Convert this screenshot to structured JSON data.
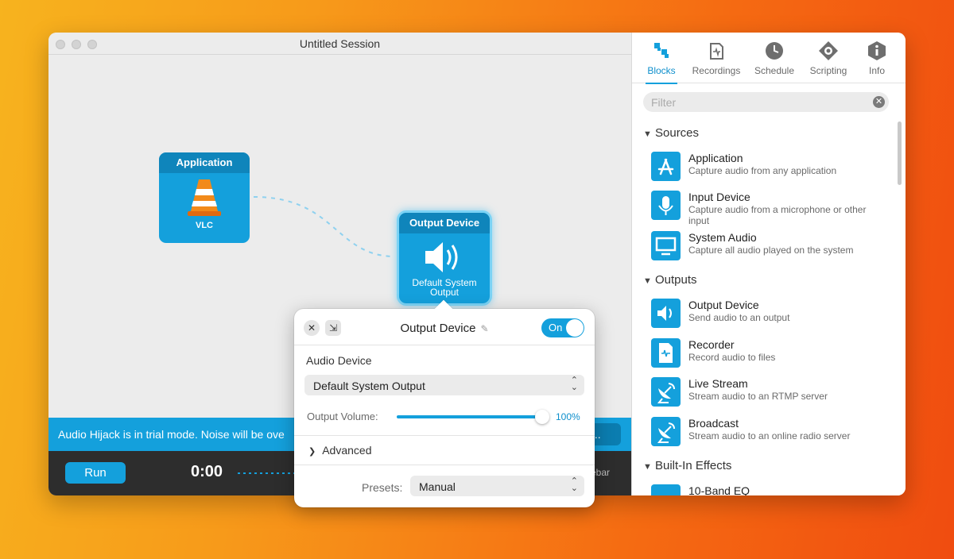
{
  "window": {
    "title": "Untitled Session"
  },
  "canvas": {
    "app_block": {
      "header": "Application",
      "label": "VLC"
    },
    "output_block": {
      "header": "Output Device",
      "label": "Default System Output"
    }
  },
  "trial": {
    "message": "Audio Hijack is in trial mode. Noise will be ove",
    "button_label": "s..."
  },
  "bottom": {
    "run_label": "Run",
    "timer": "0:00",
    "sidebar_label": "ebar"
  },
  "sidebar": {
    "tabs": [
      {
        "label": "Blocks",
        "icon": "blocks-icon",
        "active": true
      },
      {
        "label": "Recordings",
        "icon": "recordings-icon"
      },
      {
        "label": "Schedule",
        "icon": "clock-icon"
      },
      {
        "label": "Scripting",
        "icon": "scripting-icon"
      },
      {
        "label": "Info",
        "icon": "info-icon"
      }
    ],
    "filter_placeholder": "Filter",
    "sections": [
      {
        "title": "Sources",
        "items": [
          {
            "title": "Application",
            "desc": "Capture audio from any application",
            "icon": "app-store-icon"
          },
          {
            "title": "Input Device",
            "desc": "Capture audio from a microphone or other input",
            "icon": "microphone-icon"
          },
          {
            "title": "System Audio",
            "desc": "Capture all audio played on the system",
            "icon": "monitor-icon"
          }
        ]
      },
      {
        "title": "Outputs",
        "items": [
          {
            "title": "Output Device",
            "desc": "Send audio to an output",
            "icon": "speaker-icon"
          },
          {
            "title": "Recorder",
            "desc": "Record audio to files",
            "icon": "recorder-icon"
          },
          {
            "title": "Live Stream",
            "desc": "Stream audio to an RTMP server",
            "icon": "satellite-icon"
          },
          {
            "title": "Broadcast",
            "desc": "Stream audio to an online radio server",
            "icon": "broadcast-icon"
          }
        ]
      },
      {
        "title": "Built-In Effects",
        "items": [
          {
            "title": "10-Band EQ",
            "desc": "",
            "icon": "eq-icon"
          }
        ]
      }
    ]
  },
  "popover": {
    "title": "Output Device",
    "toggle_label": "On",
    "audio_device_label": "Audio Device",
    "audio_device_value": "Default System Output",
    "volume_label": "Output Volume:",
    "volume_value": "100%",
    "volume_level": 1.0,
    "advanced_label": "Advanced",
    "presets_label": "Presets:",
    "presets_value": "Manual"
  },
  "colors": {
    "accent": "#14a0dc",
    "accent_dark": "#0f85bb"
  }
}
